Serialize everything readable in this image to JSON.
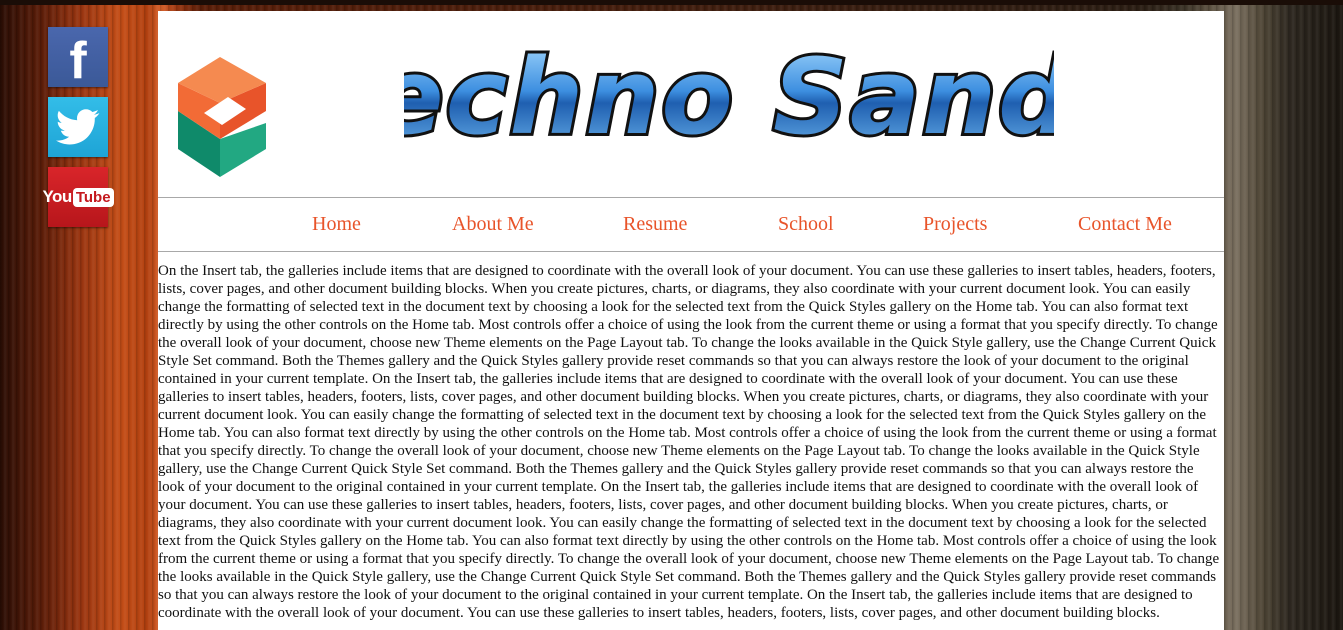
{
  "social": {
    "facebook_glyph": "f",
    "youtube_you": "You",
    "youtube_tube": "Tube"
  },
  "brand": {
    "title": "Techno Sandy"
  },
  "nav": {
    "items": [
      "Home",
      "About Me",
      "Resume",
      "School",
      "Projects",
      "Contact Me"
    ]
  },
  "content": {
    "text": "On the Insert tab, the galleries include items that are designed to coordinate with the overall look of your document. You can use these galleries to insert tables, headers, footers, lists, cover pages, and other document building blocks. When you create pictures, charts, or diagrams, they also coordinate with your current document look. You can easily change the formatting of selected text in the document text by choosing a look for the selected text from the Quick Styles gallery on the Home tab. You can also format text directly by using the other controls on the Home tab. Most controls offer a choice of using the look from the current theme or using a format that you specify directly. To change the overall look of your document, choose new Theme elements on the Page Layout tab. To change the looks available in the Quick Style gallery, use the Change Current Quick Style Set command. Both the Themes gallery and the Quick Styles gallery provide reset commands so that you can always restore the look of your document to the original contained in your current template. On the Insert tab, the galleries include items that are designed to coordinate with the overall look of your document. You can use these galleries to insert tables, headers, footers, lists, cover pages, and other document building blocks. When you create pictures, charts, or diagrams, they also coordinate with your current document look. You can easily change the formatting of selected text in the document text by choosing a look for the selected text from the Quick Styles gallery on the Home tab. You can also format text directly by using the other controls on the Home tab. Most controls offer a choice of using the look from the current theme or using a format that you specify directly. To change the overall look of your document, choose new Theme elements on the Page Layout tab. To change the looks available in the Quick Style gallery, use the Change Current Quick Style Set command. Both the Themes gallery and the Quick Styles gallery provide reset commands so that you can always restore the look of your document to the original contained in your current template. On the Insert tab, the galleries include items that are designed to coordinate with the overall look of your document. You can use these galleries to insert tables, headers, footers, lists, cover pages, and other document building blocks. When you create pictures, charts, or diagrams, they also coordinate with your current document look. You can easily change the formatting of selected text in the document text by choosing a look for the selected text from the Quick Styles gallery on the Home tab. You can also format text directly by using the other controls on the Home tab. Most controls offer a choice of using the look from the current theme or using a format that you specify directly. To change the overall look of your document, choose new Theme elements on the Page Layout tab. To change the looks available in the Quick Style gallery, use the Change Current Quick Style Set command. Both the Themes gallery and the Quick Styles gallery provide reset commands so that you can always restore the look of your document to the original contained in your current template. On the Insert tab, the galleries include items that are designed to coordinate with the overall look of your document. You can use these galleries to insert tables, headers, footers, lists, cover pages, and other document building blocks."
  },
  "colors": {
    "nav_link": "#e8542a",
    "logo_orange": "#f0612d",
    "logo_teal": "#1f9e7e",
    "wordmark_blue": "#3d8fe0"
  }
}
